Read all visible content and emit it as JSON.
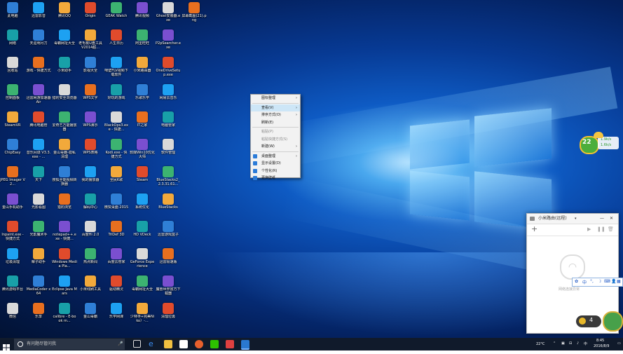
{
  "desktop": {
    "icons": [
      [
        "此电脑",
        "迅雷影音",
        "腾讯QQ",
        "Origin",
        "GEAK Watch",
        "腾讯视频",
        "Ghost安装器.exe",
        "屏幕截图(21).png"
      ],
      [
        "网络",
        "天涯明月刀",
        "毒霸网址大全",
        "老毛桃U盘工具V2014超...",
        "人生日历",
        "阿里旺旺",
        "P2pSearcher.exe"
      ],
      [
        "回收站",
        "游戏 - 快捷方式",
        "小米助手",
        "影视大全",
        "咪壁FLV视频下载软件",
        "小米路由器",
        "OneDriveSetup.exe"
      ],
      [
        "控制面板",
        "迅雷网游加速器Air",
        "猎豹安全浏览器",
        "WPS文字",
        "好玩的游戏",
        "乐歌乐学",
        "网易云音乐"
      ],
      [
        "SteamVR",
        "腾讯电脑管",
        "爱奇艺万能播放器",
        "WPS演示",
        "BlackOps3.exe - 快捷...",
        "IT之家",
        "电脑管家"
      ],
      [
        "ChipEasy",
        "音乐间谍 V3.3.exe - ...",
        "金山毒霸-隐私清理",
        "WPS表格",
        "Kodi.exe - 快捷方式",
        "软媒Win10优化大师",
        "软件管理"
      ],
      [
        "JPEG Imager V2...",
        "天下",
        "搜狐全能视频转换器",
        "我的播放器",
        "全民K歌",
        "Steam",
        "BlueStacks2_2.3.31.61..."
      ],
      [
        "金山手机助手",
        "光影看图",
        "猎豹浏览",
        "解码中心",
        "微赞桌面 2015",
        "系统优化",
        "BlueStacks"
      ],
      [
        "Inpaint.exe - 快捷方式",
        "光影魔术手",
        "notepad++.exe - 快捷...",
        "百度Hi 2.0",
        "TriDef 3D",
        "HD VDeck",
        "迅雷游戏盒子"
      ],
      [
        "垃圾清理",
        "椰子助手",
        "Windows Media Pla...",
        "热点新闻",
        "百度云管家",
        "GeForce Experience",
        "迅雷极速版"
      ],
      [
        "腾讯游戏平台",
        "MediaCoder x64",
        "Eclipse Java Mars",
        "小米线刷工具",
        "驱动精灵",
        "毒霸网址大全",
        "魔兽世界官方下载器"
      ],
      [
        "微信",
        "乐享",
        "calibre - E-book m...",
        "金山毒霸",
        "乐学网课",
        "少林寺+完美Niko）-...",
        "清理垃圾"
      ]
    ],
    "icon_colors": [
      "#2f7fd6",
      "#1da1f2",
      "#f2a93b",
      "#e04b2c",
      "#3cb371",
      "#7a4fd0",
      "#d9d9d9",
      "#e86f1f",
      "#18a0a8"
    ]
  },
  "context_menu": {
    "items": [
      {
        "label": "图标整理",
        "arrow": "›",
        "icon": "",
        "disabled": false,
        "highlight": false
      },
      {
        "sep": true
      },
      {
        "label": "查看(V)",
        "arrow": "›",
        "icon": "",
        "disabled": false,
        "highlight": true
      },
      {
        "label": "排序方式(O)",
        "arrow": "›",
        "icon": "",
        "disabled": false,
        "highlight": false
      },
      {
        "label": "刷新(E)",
        "arrow": "",
        "icon": "",
        "disabled": false,
        "highlight": false
      },
      {
        "sep": true
      },
      {
        "label": "粘贴(P)",
        "arrow": "",
        "icon": "",
        "disabled": true,
        "highlight": false
      },
      {
        "label": "粘贴快捷方式(S)",
        "arrow": "",
        "icon": "",
        "disabled": true,
        "highlight": false
      },
      {
        "label": "新建(W)",
        "arrow": "›",
        "icon": "",
        "disabled": false,
        "highlight": false
      },
      {
        "sep": true
      },
      {
        "label": "桌面整理",
        "arrow": "›",
        "icon": "#2b7bd8",
        "disabled": false,
        "highlight": false
      },
      {
        "label": "显示设置(D)",
        "arrow": "",
        "icon": "#2b7bd8",
        "disabled": false,
        "highlight": false
      },
      {
        "label": "个性化(R)",
        "arrow": "",
        "icon": "#2b7bd8",
        "disabled": false,
        "highlight": false
      },
      {
        "label": "更换壁纸",
        "arrow": "",
        "icon": "#2b7bd8",
        "disabled": false,
        "highlight": false
      }
    ]
  },
  "mi_window": {
    "title": "小米路由(远程)",
    "status_text": "网络连接异常",
    "close": "✕",
    "minimize": "—",
    "add": "+",
    "medal_count": "4"
  },
  "weather_widget": {
    "temp": "22",
    "line1": "1.9k/s",
    "line2": "1.6k/s"
  },
  "ime_bar": {
    "lang": "中"
  },
  "taskbar": {
    "search_placeholder": "有问题尽管问我",
    "weather": "22°C",
    "time": "8:45",
    "date": "2016/8/9"
  }
}
